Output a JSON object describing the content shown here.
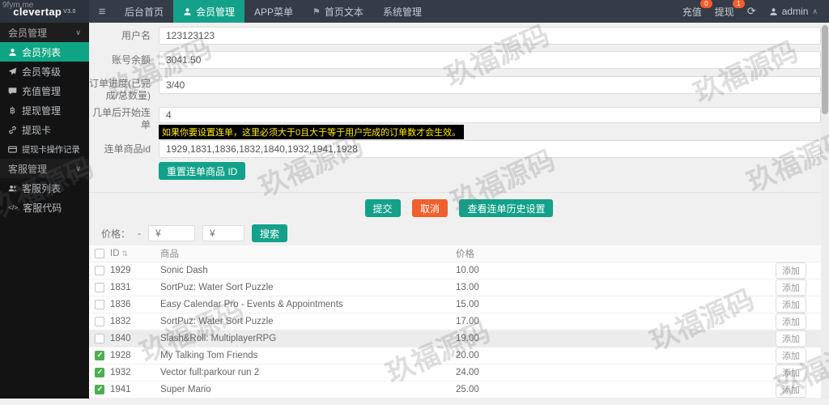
{
  "watermark": {
    "corner": "9fym.me",
    "tile": "玖福源码"
  },
  "icons": {
    "menu": "≡",
    "refresh": "⟳",
    "flag": "⚑",
    "chevron_down": "∨",
    "caret_up": "∧",
    "sort": "⇅",
    "baht": "฿",
    "code": "</>"
  },
  "topbar": {
    "logo": "clevertap",
    "version": "V3.0",
    "nav": [
      {
        "label": "后台首页"
      },
      {
        "label": "会员管理"
      },
      {
        "label": "APP菜单"
      },
      {
        "label": "首页文本"
      },
      {
        "label": "系统管理"
      }
    ],
    "recharge": "充值",
    "recharge_badge": "0",
    "withdraw": "提现",
    "withdraw_badge": "1",
    "user": "admin"
  },
  "sidebar": {
    "section1": "会员管理",
    "section2": "客服管理",
    "items": [
      {
        "label": "会员列表"
      },
      {
        "label": "会员等级"
      },
      {
        "label": "充值管理"
      },
      {
        "label": "提现管理"
      },
      {
        "label": "提现卡"
      },
      {
        "label": "提现卡操作记录"
      },
      {
        "label": "客服列表"
      },
      {
        "label": "客服代码"
      }
    ]
  },
  "form": {
    "fields": [
      {
        "label": "用户名",
        "value": "123123123"
      },
      {
        "label": "账号余额",
        "value": "3041.50"
      },
      {
        "label": "订单进度(已完成/总数量)",
        "value": "3/40"
      },
      {
        "label": "几单后开始连单",
        "value": "4"
      },
      {
        "label": "连单商品id",
        "value": "1929,1831,1836,1832,1840,1932,1941,1928"
      }
    ],
    "hint": "如果你要设置连单，这里必须大于0且大于等于用户完成的订单数才会生效。",
    "reset_button": "重置连单商品 ID",
    "submit": "提交",
    "cancel": "取消",
    "history": "查看连单历史设置"
  },
  "search": {
    "label": "价格：",
    "separator": "-",
    "min_placeholder": "¥",
    "max_placeholder": "¥",
    "button": "搜索"
  },
  "table": {
    "header_id": "ID",
    "header_product": "商品",
    "header_price": "价格",
    "add_label": "添加",
    "rows": [
      {
        "id": "1929",
        "product": "Sonic Dash",
        "price": "10.00",
        "checked": false
      },
      {
        "id": "1831",
        "product": "SortPuz: Water Sort Puzzle",
        "price": "13.00",
        "checked": false
      },
      {
        "id": "1836",
        "product": "Easy Calendar Pro - Events & Appointments",
        "price": "15.00",
        "checked": false
      },
      {
        "id": "1832",
        "product": "SortPuz: Water Sort Puzzle",
        "price": "17.00",
        "checked": false
      },
      {
        "id": "1840",
        "product": "Slash&Roll: MultiplayerRPG",
        "price": "19.00",
        "checked": false
      },
      {
        "id": "1928",
        "product": "My Talking Tom Friends",
        "price": "20.00",
        "checked": true
      },
      {
        "id": "1932",
        "product": "Vector full:parkour run 2",
        "price": "24.00",
        "checked": true
      },
      {
        "id": "1941",
        "product": "Super Mario",
        "price": "25.00",
        "checked": true
      }
    ]
  },
  "colors": {
    "teal": "#13a18a",
    "orange": "#f0602c",
    "green": "#4caf50",
    "badge": "#ff5b2e",
    "topbar": "#353c47",
    "sidebar": "#131313",
    "hint_text": "#ffeb00"
  }
}
